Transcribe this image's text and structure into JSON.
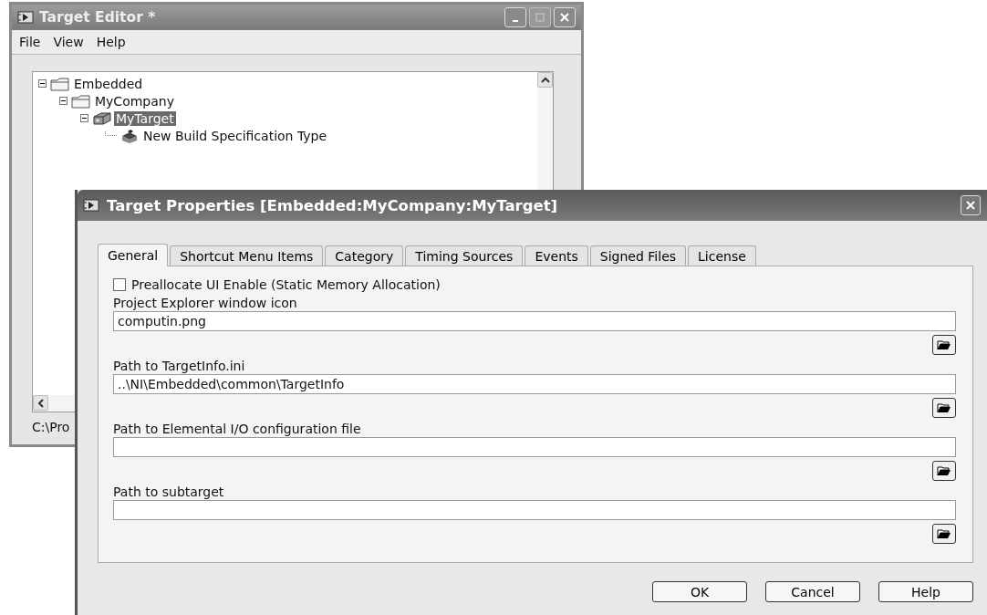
{
  "editor": {
    "title": "Target Editor *",
    "menu": [
      "File",
      "View",
      "Help"
    ],
    "tree": [
      {
        "label": "Embedded",
        "kind": "folder",
        "expanded": true,
        "selected": false,
        "children": [
          {
            "label": "MyCompany",
            "kind": "folder",
            "expanded": true,
            "selected": false,
            "children": [
              {
                "label": "MyTarget",
                "kind": "target",
                "expanded": true,
                "selected": true,
                "children": [
                  {
                    "label": "New Build Specification Type",
                    "kind": "build",
                    "selected": false
                  }
                ]
              }
            ]
          }
        ]
      }
    ],
    "status": "C:\\Pro"
  },
  "dialog": {
    "title": "Target Properties [Embedded:MyCompany:MyTarget]",
    "tabs": [
      {
        "label": "General",
        "selected": true
      },
      {
        "label": "Shortcut Menu Items",
        "selected": false
      },
      {
        "label": "Category",
        "selected": false
      },
      {
        "label": "Timing Sources",
        "selected": false
      },
      {
        "label": "Events",
        "selected": false
      },
      {
        "label": "Signed Files",
        "selected": false
      },
      {
        "label": "License",
        "selected": false
      }
    ],
    "checkbox": {
      "label": "Preallocate UI Enable (Static Memory Allocation)",
      "checked": false
    },
    "fields": [
      {
        "label": "Project Explorer window icon",
        "value": "computin.png"
      },
      {
        "label": "Path to TargetInfo.ini",
        "value": "..\\NI\\Embedded\\common\\TargetInfo"
      },
      {
        "label": "Path to Elemental I/O configuration file"
      },
      {
        "label": "Path to subtarget"
      }
    ],
    "buttons": [
      "OK",
      "Cancel",
      "Help"
    ]
  }
}
